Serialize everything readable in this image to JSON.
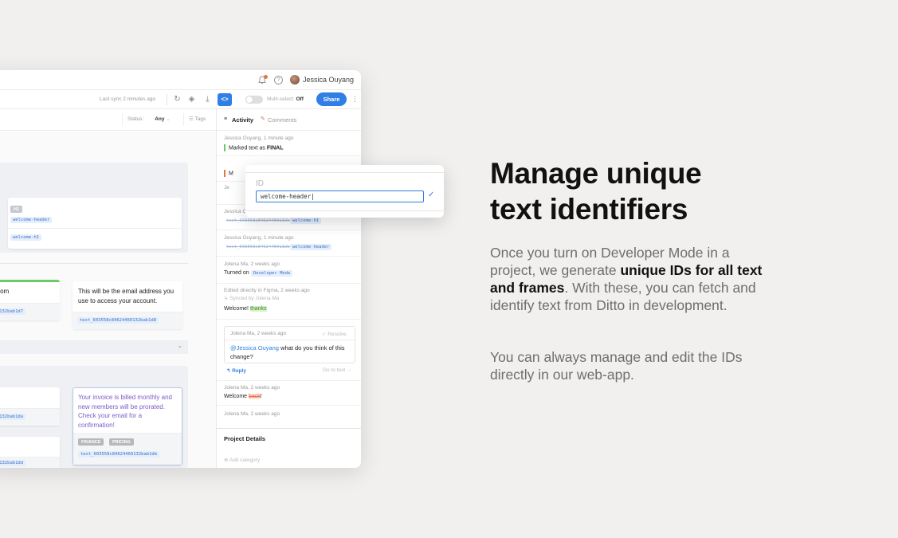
{
  "header": {
    "user_name": "Jessica Ouyang",
    "last_sync": "Last sync 2 minutes ago",
    "multiselect_label": "Multi-select:",
    "multiselect_state": "Off",
    "share_label": "Share"
  },
  "filters": {
    "status_label": "Status:",
    "status_value": "Any",
    "tags_label": "Tags"
  },
  "canvas": {
    "h1_tag": "H1",
    "welcome_header_id": "welcome-header",
    "welcome_h1_id": "welcome-h1",
    "email_partial": "ny.com",
    "email_partial_id": "4460132bab1d7",
    "email_text": "This will be the email address you use to access your account.",
    "email_id": "text_603558c84624460132bab1d8",
    "row1_id": "4460132bab1da",
    "invoice_text": "Your invoice is billed monthly and new members will be prorated. Check your email for a confirmation!",
    "invoice_tags": [
      "FINANCE",
      "PRICING"
    ],
    "invoice_id": "text_603558c84624460132bab1db",
    "row2_id": "4460132bab1dd"
  },
  "activity": {
    "tab_activity": "Activity",
    "tab_comments": "Comments",
    "items": [
      {
        "meta": "Jessica Ouyang, 1 minute ago",
        "text_prefix": "Marked text as ",
        "text_bold": "FINAL"
      },
      {
        "meta": "Jessica Ouyang, 1 minute ago",
        "old_id": "text_603558c84624460132bab1d8",
        "new_id": "welcome-h1"
      },
      {
        "meta": "Jessica Ouyang, 1 minute ago",
        "old_id": "text_603558c84624460132bab1d8",
        "new_id": "welcome-header"
      },
      {
        "meta": "Jolena Ma, 2 weeks ago",
        "text": "Turned on ",
        "chip": "Developer Mode"
      },
      {
        "meta": "Edited directly in Figma, 2 weeks ago",
        "sub": "Synced by Jolena Ma",
        "text": "Welcome! ",
        "highlight": "thanks"
      }
    ],
    "comment": {
      "meta": "Jolena Ma, 2 weeks ago",
      "resolve": "Resolve",
      "mention": "@Jessica Ouyang",
      "text": " what do you think of this change?",
      "reply": "Reply",
      "goto": "Go to text"
    },
    "item6": {
      "meta": "Jolena Ma, 2 weeks ago",
      "text": "Welcome",
      "struck": "back",
      "suffix": "!"
    },
    "item7": {
      "meta": "Jolena Ma, 2 weeks ago"
    },
    "project_details": "Project Details",
    "add_category": "Add category"
  },
  "popup": {
    "label": "ID",
    "value": "welcome-header"
  },
  "marketing": {
    "headline_line1": "Manage unique",
    "headline_line2": "text identifiers",
    "p1_a": "Once you turn on Developer Mode in a project, we generate ",
    "p1_bold": "unique IDs for all text and frames",
    "p1_b": ". With these, you can fetch and identify text from Ditto in development.",
    "p2": "You can always manage and edit the IDs directly in our web-app."
  },
  "colors": {
    "accent": "#2f7fe6",
    "final_green": "#6bc86b",
    "purple": "#7c5cc8"
  }
}
